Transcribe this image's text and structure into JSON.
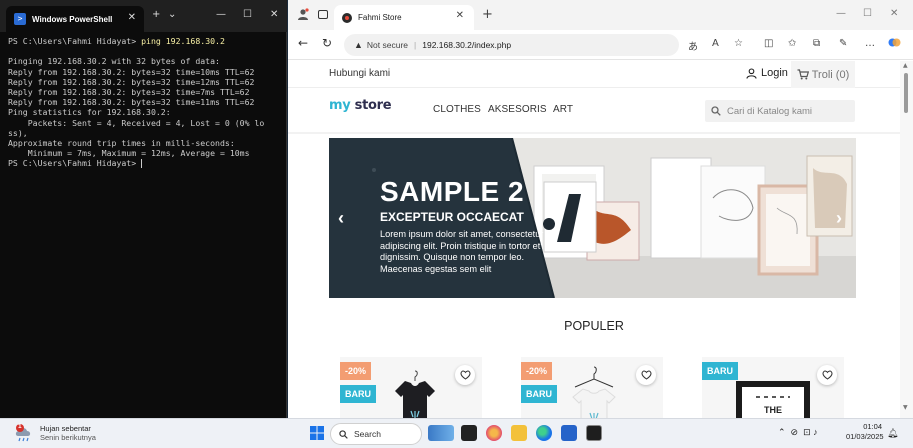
{
  "powershell": {
    "tab_title": "Windows PowerShell",
    "prompt": "PS C:\\Users\\Fahmi Hidayat>",
    "command": "ping 192.168.30.2",
    "output_lines": [
      "",
      "Pinging 192.168.30.2 with 32 bytes of data:",
      "Reply from 192.168.30.2: bytes=32 time=10ms TTL=62",
      "Reply from 192.168.30.2: bytes=32 time=12ms TTL=62",
      "Reply from 192.168.30.2: bytes=32 time=7ms TTL=62",
      "Reply from 192.168.30.2: bytes=32 time=11ms TTL=62",
      "Ping statistics for 192.168.30.2:",
      "    Packets: Sent = 4, Received = 4, Lost = 0 (0% lo",
      "ss),",
      "Approximate round trip times in milli-seconds:",
      "    Minimum = 7ms, Maximum = 12ms, Average = 10ms"
    ],
    "final_prompt": "PS C:\\Users\\Fahmi Hidayat> "
  },
  "browser": {
    "tab_title": "Fahmi Store",
    "security_label": "Not secure",
    "url": "192.168.30.2/index.php"
  },
  "site": {
    "contact_label": "Hubungi kami",
    "login_label": "Login",
    "cart_label": "Troli (0)",
    "logo_my": "my",
    "logo_store": "store",
    "nav": [
      "CLOTHES",
      "AKSESORIS",
      "ART"
    ],
    "search_placeholder": "Cari di Katalog kami",
    "hero": {
      "title": "SAMPLE 2",
      "subtitle": "EXCEPTEUR OCCAECAT",
      "body": "Lorem ipsum dolor sit amet, consectetur adipiscing elit. Proin tristique in tortor et dignissim. Quisque non tempor leo. Maecenas egestas sem elit"
    },
    "section_title": "POPULER",
    "products": [
      {
        "discount": "-20%",
        "badge": "BARU"
      },
      {
        "discount": "-20%",
        "badge": "BARU"
      },
      {
        "badge": "BARU",
        "poster_text": "THE"
      }
    ]
  },
  "taskbar": {
    "weather_title": "Hujan sebentar",
    "weather_sub": "Senin berikutnya",
    "weather_badge": "1",
    "search_label": "Search",
    "time": "01:04",
    "date": "01/03/2025"
  },
  "colors": {
    "brand": "#2fb5d2",
    "discount": "#f39d72",
    "hero_dark": "#25333d",
    "terminal_bg": "#0c0c0c"
  }
}
